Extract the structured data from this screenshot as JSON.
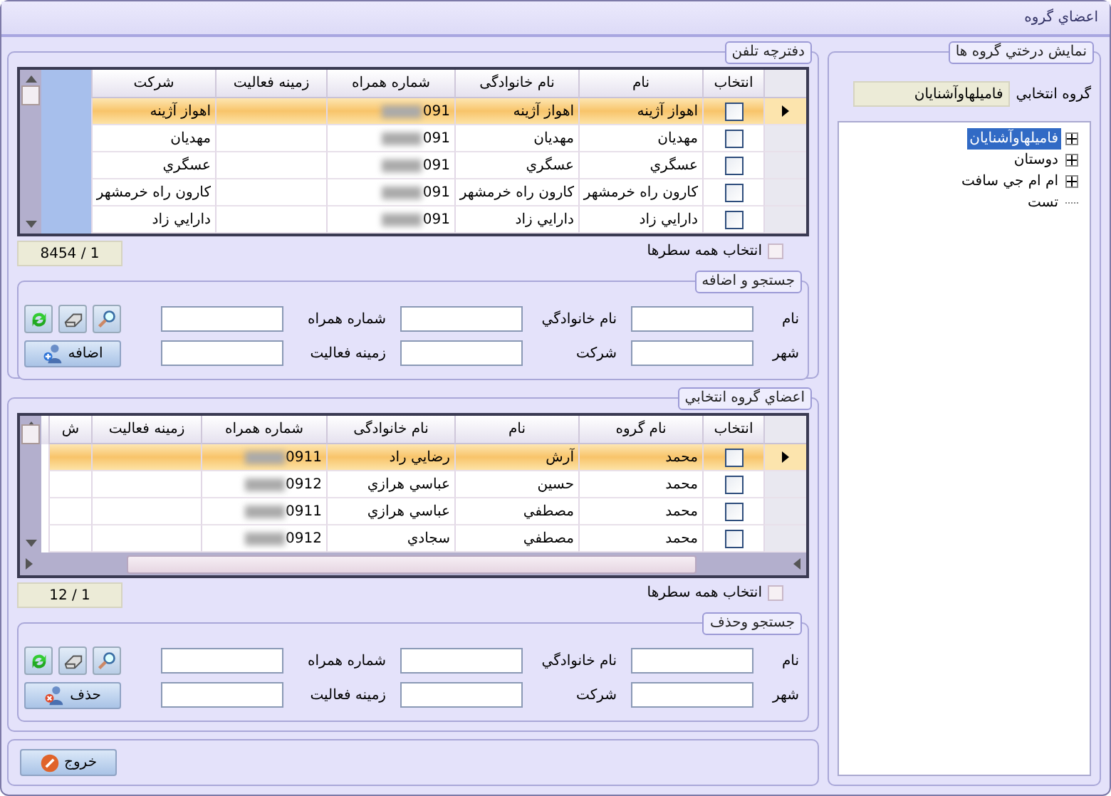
{
  "window": {
    "title": "اعضاي گروه"
  },
  "tree_panel": {
    "title": "نمايش درختي گروه ها",
    "selected_group_label": "گروه انتخابي",
    "selected_group_value": "فاميلهاوآشنايان",
    "tree": [
      {
        "label": "فاميلهاوآشنايان",
        "selected": true,
        "expandable": true
      },
      {
        "label": "دوستان",
        "selected": false,
        "expandable": true
      },
      {
        "label": "ام ام جي سافت",
        "selected": false,
        "expandable": true
      },
      {
        "label": "تست",
        "selected": false,
        "expandable": false
      }
    ]
  },
  "phonebook": {
    "title": "دفترچه تلفن",
    "columns": [
      {
        "label": "انتخاب",
        "kind": "check"
      },
      {
        "label": "نام",
        "kind": "text"
      },
      {
        "label": "نام خانوادگی",
        "kind": "text"
      },
      {
        "label": "شماره همراه",
        "kind": "phone"
      },
      {
        "label": "زمینه فعالیت",
        "kind": "text"
      },
      {
        "label": "شرکت",
        "kind": "text"
      }
    ],
    "rows": [
      {
        "selected": true,
        "checked": false,
        "cells": [
          "",
          "اهواز آژينه",
          "اهواز آژينه",
          "091",
          "",
          "اهواز آژينه"
        ]
      },
      {
        "selected": false,
        "checked": false,
        "cells": [
          "",
          "مهديان",
          "مهديان",
          "091",
          "",
          "مهديان"
        ]
      },
      {
        "selected": false,
        "checked": false,
        "cells": [
          "",
          "عسگري",
          "عسگري",
          "091",
          "",
          "عسگري"
        ]
      },
      {
        "selected": false,
        "checked": false,
        "cells": [
          "",
          "كارون راه خرمشهر",
          "كارون راه خرمشهر",
          "091",
          "",
          "كارون راه خرمشهر"
        ]
      },
      {
        "selected": false,
        "checked": false,
        "cells": [
          "",
          "دارايي زاد",
          "دارايي زاد",
          "091",
          "",
          "دارايي زاد"
        ]
      }
    ],
    "select_all": {
      "label": "انتخاب همه سطرها",
      "checked": false
    },
    "counter": "1 / 8454",
    "search": {
      "title": "جستجو و اضافه",
      "fields": [
        "نام",
        "نام خانوادگي",
        "شماره همراه",
        "شهر",
        "شرکت",
        "زمينه فعاليت"
      ],
      "action_button": {
        "label": "اضافه",
        "kind": "add"
      }
    }
  },
  "members": {
    "title": "اعضاي گروه انتخابي",
    "columns": [
      {
        "label": "انتخاب",
        "kind": "check"
      },
      {
        "label": "نام گروه",
        "kind": "text"
      },
      {
        "label": "نام",
        "kind": "text"
      },
      {
        "label": "نام خانوادگی",
        "kind": "text"
      },
      {
        "label": "شماره همراه",
        "kind": "phone"
      },
      {
        "label": "زمینه فعالیت",
        "kind": "text"
      },
      {
        "label": "ش",
        "kind": "text"
      }
    ],
    "rows": [
      {
        "selected": true,
        "checked": false,
        "cells": [
          "",
          "محمد",
          "آرش",
          "رضايي راد",
          "0911",
          "",
          ""
        ]
      },
      {
        "selected": false,
        "checked": false,
        "cells": [
          "",
          "محمد",
          "حسين",
          "عباسي هرازي",
          "0912",
          "",
          ""
        ]
      },
      {
        "selected": false,
        "checked": false,
        "cells": [
          "",
          "محمد",
          "مصطفي",
          "عباسي هرازي",
          "0911",
          "",
          ""
        ]
      },
      {
        "selected": false,
        "checked": false,
        "cells": [
          "",
          "محمد",
          "مصطفي",
          "سجادي",
          "0912",
          "",
          ""
        ]
      }
    ],
    "select_all": {
      "label": "انتخاب همه سطرها",
      "checked": false
    },
    "counter": "1 / 12",
    "search": {
      "title": "جستجو وحذف",
      "fields": [
        "نام",
        "نام خانوادگي",
        "شماره همراه",
        "شهر",
        "شرکت",
        "زمينه فعاليت"
      ],
      "action_button": {
        "label": "حذف",
        "kind": "remove"
      }
    }
  },
  "exit_button": "خروج"
}
